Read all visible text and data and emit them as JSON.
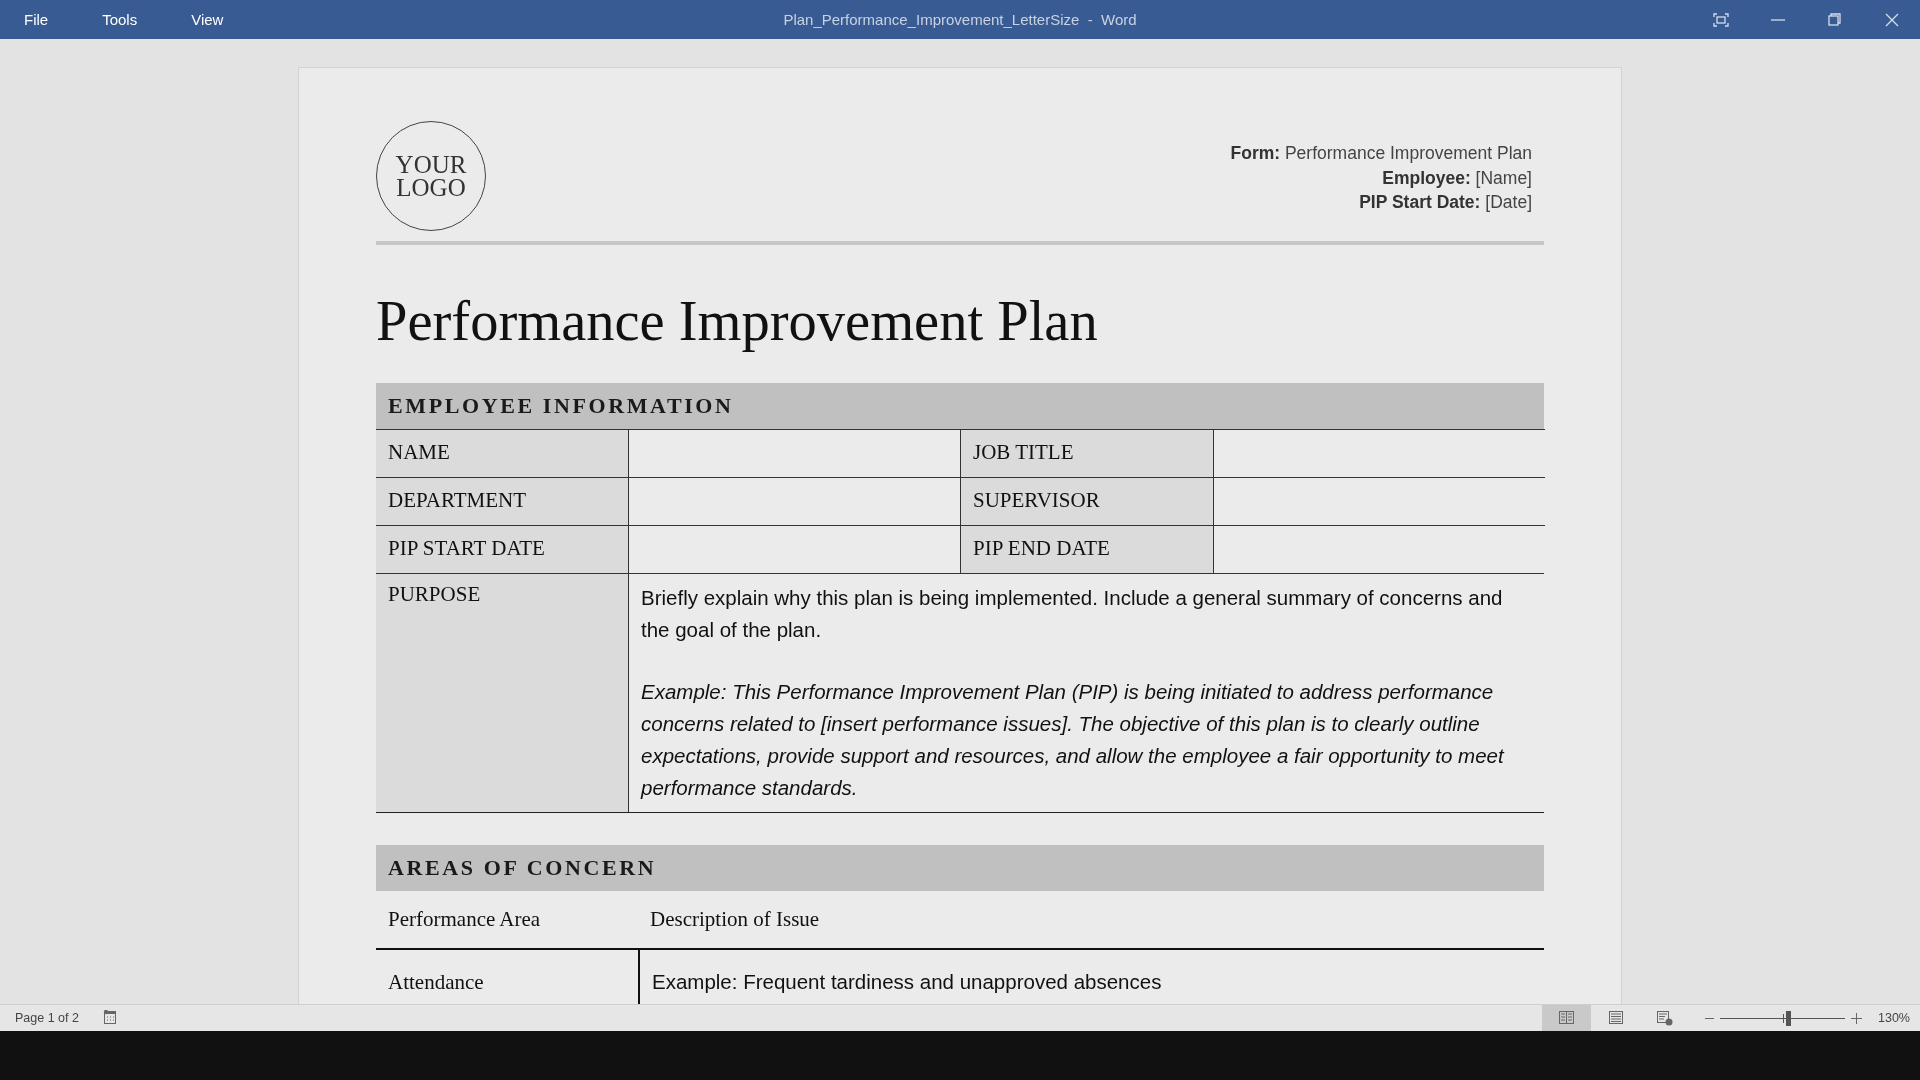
{
  "window": {
    "title": "Plan_Performance_Improvement_LetterSize  -  Word",
    "menu": [
      {
        "label": "File"
      },
      {
        "label": "Tools"
      },
      {
        "label": "View"
      }
    ]
  },
  "document": {
    "logo": [
      "YOUR",
      "LOGO"
    ],
    "header_fields": [
      "**Form:** Performance Improvement Plan",
      "**Employee:** [Name]",
      "**PIP Start Date:** [Date]"
    ],
    "title": "Performance Improvement Plan",
    "employee_information": {
      "heading": "EMPLOYEE INFORMATION",
      "rows": [
        {
          "left_label": "NAME",
          "right_label": "JOB TITLE"
        },
        {
          "left_label": "DEPARTMENT",
          "right_label": "SUPERVISOR"
        },
        {
          "left_label": "PIP START DATE",
          "right_label": "PIP END DATE"
        }
      ],
      "purpose": {
        "label": "PURPOSE",
        "paragraphs": [
          {
            "kind": "instruction",
            "text": "Briefly explain why this plan is being implemented. Include a general summary of concerns and the goal of the plan."
          },
          {
            "kind": "example",
            "text": "Example: This Performance Improvement Plan (PIP) is being initiated to address performance concerns related to [insert performance issues]. The objective of this plan is to clearly outline expectations, provide support and resources, and allow the employee a fair opportunity to meet performance standards."
          }
        ]
      }
    },
    "areas_of_concern": {
      "heading": "AREAS OF CONCERN",
      "columns": [
        "Performance Area",
        "Description of Issue"
      ],
      "rows": [
        {
          "area": "Attendance",
          "description": "Example: Frequent tardiness and unapproved absences"
        }
      ]
    }
  },
  "status_bar": {
    "page": "Page 1 of 2",
    "views": [
      {
        "kind": "read",
        "selected": true
      },
      {
        "kind": "print",
        "selected": false
      },
      {
        "kind": "web",
        "selected": false
      }
    ],
    "zoom": {
      "level": 0.54,
      "reading": "130%"
    }
  }
}
